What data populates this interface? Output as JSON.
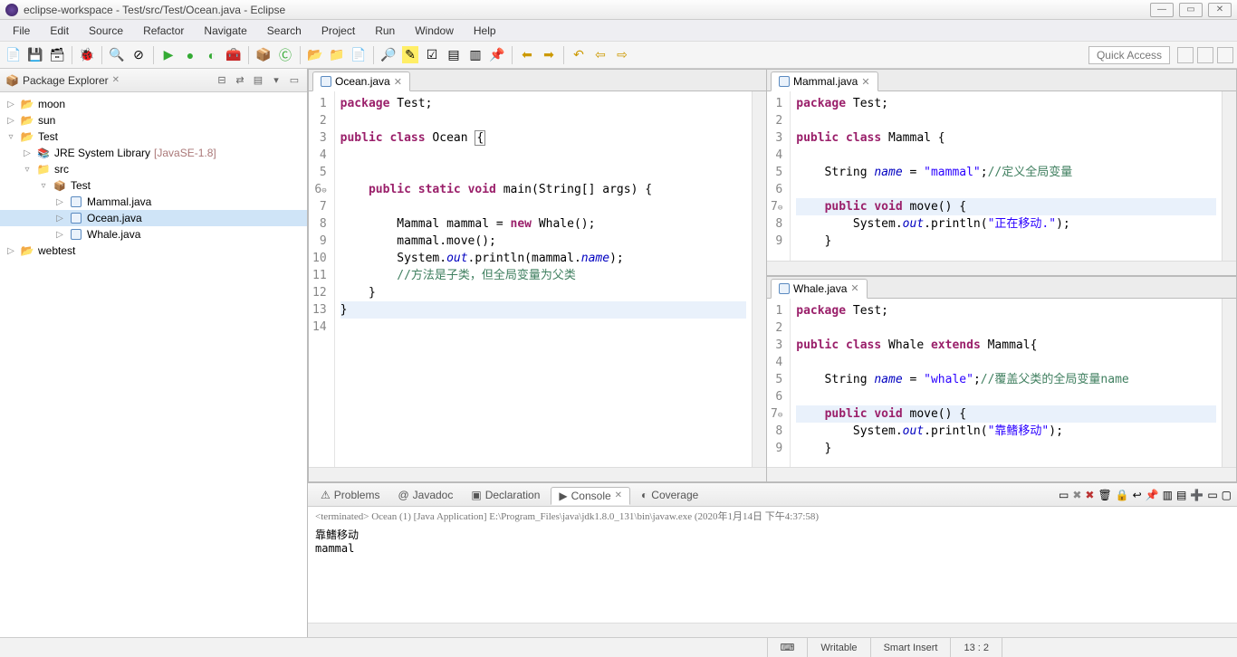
{
  "window": {
    "title": "eclipse-workspace - Test/src/Test/Ocean.java - Eclipse"
  },
  "menu": [
    "File",
    "Edit",
    "Source",
    "Refactor",
    "Navigate",
    "Search",
    "Project",
    "Run",
    "Window",
    "Help"
  ],
  "quick_access": "Quick Access",
  "explorer": {
    "title": "Package Explorer",
    "items": [
      {
        "label": "moon",
        "icon": "proj",
        "depth": 0,
        "twist": "▷"
      },
      {
        "label": "sun",
        "icon": "proj",
        "depth": 0,
        "twist": "▷"
      },
      {
        "label": "Test",
        "icon": "proj",
        "depth": 0,
        "twist": "▿"
      },
      {
        "label": "JRE System Library",
        "suffix": "[JavaSE-1.8]",
        "icon": "lib",
        "depth": 1,
        "twist": "▷"
      },
      {
        "label": "src",
        "icon": "folder",
        "depth": 1,
        "twist": "▿"
      },
      {
        "label": "Test",
        "icon": "pkg",
        "depth": 2,
        "twist": "▿"
      },
      {
        "label": "Mammal.java",
        "icon": "java",
        "depth": 3,
        "twist": "▷"
      },
      {
        "label": "Ocean.java",
        "icon": "java",
        "depth": 3,
        "twist": "▷",
        "selected": true
      },
      {
        "label": "Whale.java",
        "icon": "java",
        "depth": 3,
        "twist": "▷"
      },
      {
        "label": "webtest",
        "icon": "proj",
        "depth": 0,
        "twist": "▷"
      }
    ]
  },
  "editors": {
    "ocean": {
      "tab": "Ocean.java",
      "lines": [
        {
          "n": 1,
          "html": "<span class='kw'>package</span> Test;"
        },
        {
          "n": 2,
          "html": ""
        },
        {
          "n": 3,
          "html": "<span class='kw'>public</span> <span class='kw'>class</span> Ocean <span style='border:1px solid #888;padding:0 1px'>{</span>"
        },
        {
          "n": 4,
          "html": ""
        },
        {
          "n": 5,
          "html": ""
        },
        {
          "n": 6,
          "html": "    <span class='kw'>public</span> <span class='kw'>static</span> <span class='kw'>void</span> main(String[] args) {",
          "marker": true
        },
        {
          "n": 7,
          "html": ""
        },
        {
          "n": 8,
          "html": "        Mammal <span class='typ'>mammal</span> = <span class='kw'>new</span> Whale();"
        },
        {
          "n": 9,
          "html": "        mammal.move();"
        },
        {
          "n": 10,
          "html": "        System.<span class='fld'>out</span>.println(mammal.<span class='fld'>name</span>);"
        },
        {
          "n": 11,
          "html": "        <span class='com'>//方法是子类，但全局变量为父类</span>"
        },
        {
          "n": 12,
          "html": "    }"
        },
        {
          "n": 13,
          "html": "}",
          "hl": true
        },
        {
          "n": 14,
          "html": ""
        }
      ]
    },
    "mammal": {
      "tab": "Mammal.java",
      "lines": [
        {
          "n": 1,
          "html": "<span class='kw'>package</span> Test;"
        },
        {
          "n": 2,
          "html": ""
        },
        {
          "n": 3,
          "html": "<span class='kw'>public</span> <span class='kw'>class</span> Mammal {"
        },
        {
          "n": 4,
          "html": ""
        },
        {
          "n": 5,
          "html": "    String <span class='fld'>name</span> = <span class='str'>\"mammal\"</span>;<span class='com'>//定义全局变量</span>"
        },
        {
          "n": 6,
          "html": ""
        },
        {
          "n": 7,
          "html": "    <span class='kw'>public</span> <span class='kw'>void</span> move() {",
          "marker": true,
          "hl": true
        },
        {
          "n": 8,
          "html": "        System.<span class='fld'>out</span>.println(<span class='str'>\"正在移动.\"</span>);"
        },
        {
          "n": 9,
          "html": "    }"
        }
      ]
    },
    "whale": {
      "tab": "Whale.java",
      "lines": [
        {
          "n": 1,
          "html": "<span class='kw'>package</span> Test;"
        },
        {
          "n": 2,
          "html": ""
        },
        {
          "n": 3,
          "html": "<span class='kw'>public</span> <span class='kw'>class</span> Whale <span class='kw'>extends</span> Mammal{"
        },
        {
          "n": 4,
          "html": ""
        },
        {
          "n": 5,
          "html": "    String <span class='fld'>name</span> = <span class='str'>\"whale\"</span>;<span class='com'>//覆盖父类的全局变量name</span>"
        },
        {
          "n": 6,
          "html": ""
        },
        {
          "n": 7,
          "html": "    <span class='kw'>public</span> <span class='kw'>void</span> move() {",
          "marker": true,
          "hl": true
        },
        {
          "n": 8,
          "html": "        System.<span class='fld'>out</span>.println(<span class='str'>\"靠鳍移动\"</span>);"
        },
        {
          "n": 9,
          "html": "    }"
        }
      ]
    }
  },
  "bottom": {
    "tabs": [
      "Problems",
      "Javadoc",
      "Declaration",
      "Console",
      "Coverage"
    ],
    "active": 3,
    "meta": "<terminated> Ocean (1) [Java Application] E:\\Program_Files\\java\\jdk1.8.0_131\\bin\\javaw.exe (2020年1月14日 下午4:37:58)",
    "output": [
      "靠鳍移动",
      "mammal"
    ]
  },
  "status": {
    "writable": "Writable",
    "insert": "Smart Insert",
    "pos": "13 : 2"
  }
}
